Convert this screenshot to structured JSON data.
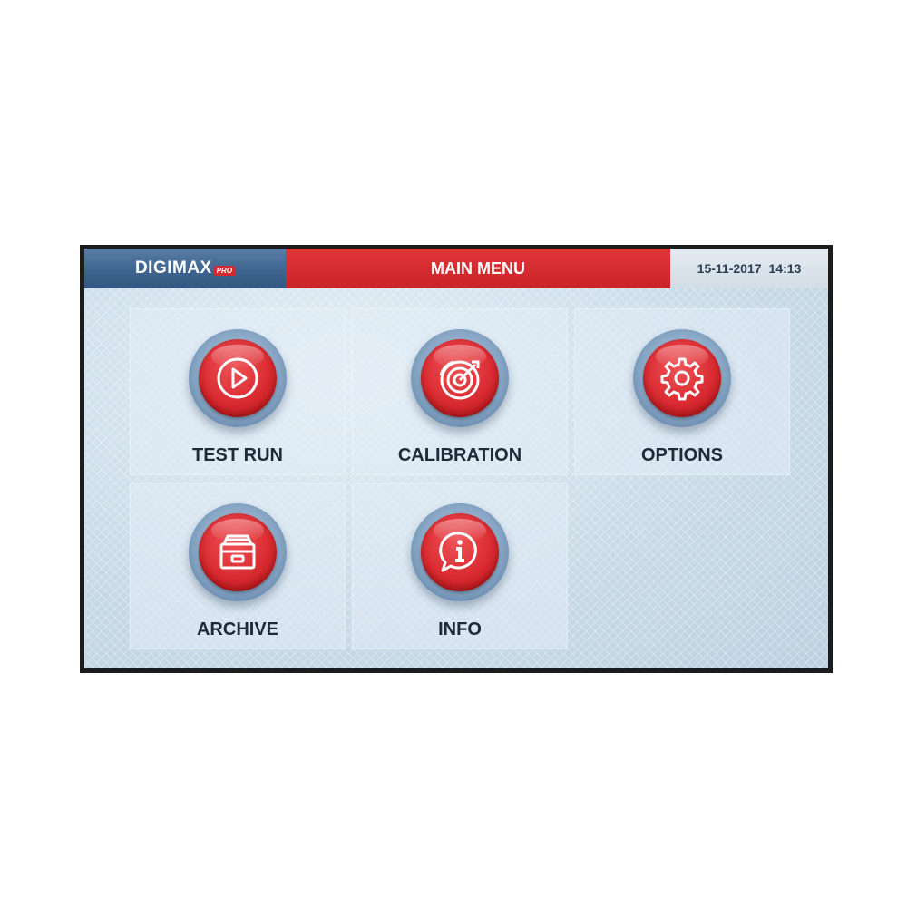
{
  "header": {
    "brand": "DIGIMAX",
    "brand_badge": "PRO",
    "title": "MAIN MENU",
    "date": "15-11-2017",
    "time": "14:13"
  },
  "menu": [
    {
      "label": "TEST RUN",
      "icon": "play-icon"
    },
    {
      "label": "CALIBRATION",
      "icon": "target-icon"
    },
    {
      "label": "OPTIONS",
      "icon": "gear-icon"
    },
    {
      "label": "ARCHIVE",
      "icon": "archive-drawer-icon"
    },
    {
      "label": "INFO",
      "icon": "info-bubble-icon"
    }
  ],
  "colors": {
    "header_blue": "#3e6590",
    "header_red": "#d32a2f",
    "button_red": "#d92b31",
    "screen_bg": "#c6d8e6"
  }
}
